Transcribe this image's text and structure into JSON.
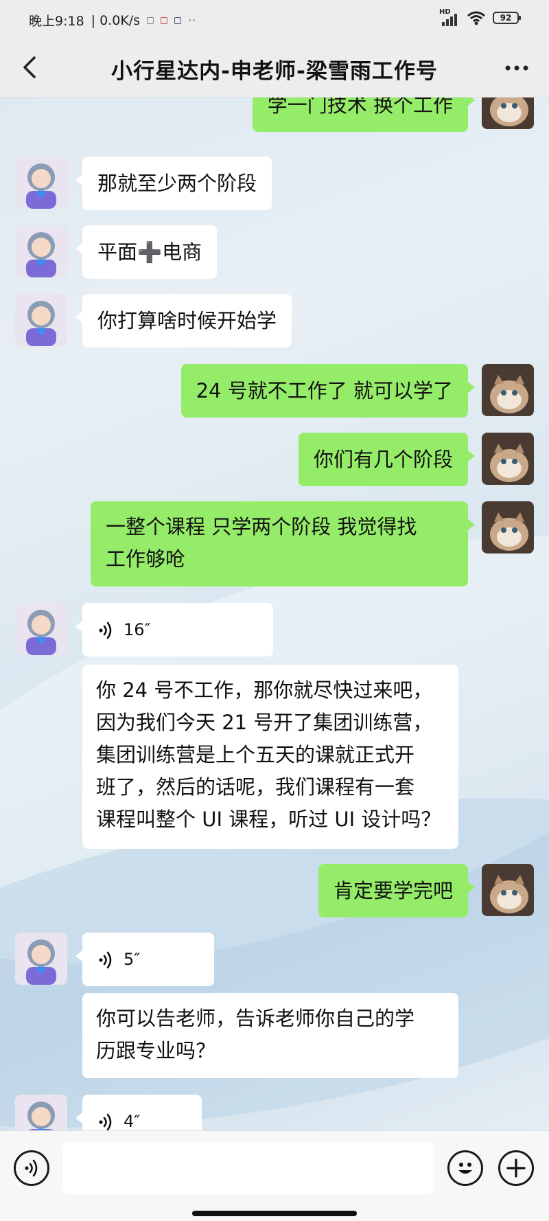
{
  "status_bar": {
    "time": "晚上9:18",
    "network_speed": "| 0.0K/s",
    "extra_icons": "··",
    "signal_tag": "HD",
    "battery_level": "92"
  },
  "header": {
    "title": "小行星达内-申老师-梁雪雨工作号",
    "back_icon": "chevron-left-icon",
    "more_icon": "more-icon"
  },
  "messages": [
    {
      "side": "right",
      "type": "text",
      "text": "学一门技术 换个工作"
    },
    {
      "side": "left",
      "type": "text",
      "text": "那就至少两个阶段"
    },
    {
      "side": "left",
      "type": "text",
      "text": "平面➕电商"
    },
    {
      "side": "left",
      "type": "text",
      "text": "你打算啥时候开始学"
    },
    {
      "side": "right",
      "type": "text",
      "text": "24 号就不工作了 就可以学了"
    },
    {
      "side": "right",
      "type": "text",
      "text": "你们有几个阶段"
    },
    {
      "side": "right",
      "type": "text",
      "lines": [
        "一整个课程 只学两个阶段 我觉得找",
        "工作够呛"
      ]
    },
    {
      "side": "left",
      "type": "voice",
      "duration": "16″"
    },
    {
      "side": "left",
      "type": "text",
      "lines": [
        "你 24 号不工作，那你就尽快过来吧，",
        "因为我们今天 21 号开了集团训练营，",
        "集团训练营是上个五天的课就正式开",
        "班了，然后的话呢，我们课程有一套",
        "课程叫整个 UI 课程，听过 UI 设计吗？"
      ]
    },
    {
      "side": "right",
      "type": "text",
      "text": "肯定要学完吧"
    },
    {
      "side": "left",
      "type": "voice",
      "duration": "5″"
    },
    {
      "side": "left",
      "type": "text",
      "lines": [
        "你可以告老师，告诉老师你自己的学",
        "历跟专业吗？"
      ]
    },
    {
      "side": "left",
      "type": "voice",
      "duration": "4″"
    }
  ],
  "input_bar": {
    "voice_icon": "voice-icon",
    "emoji_icon": "emoji-icon",
    "plus_icon": "plus-icon",
    "input_value": ""
  },
  "colors": {
    "outgoing_bubble": "#95ec69",
    "incoming_bubble": "#ffffff",
    "bar_background": "#ededed"
  }
}
